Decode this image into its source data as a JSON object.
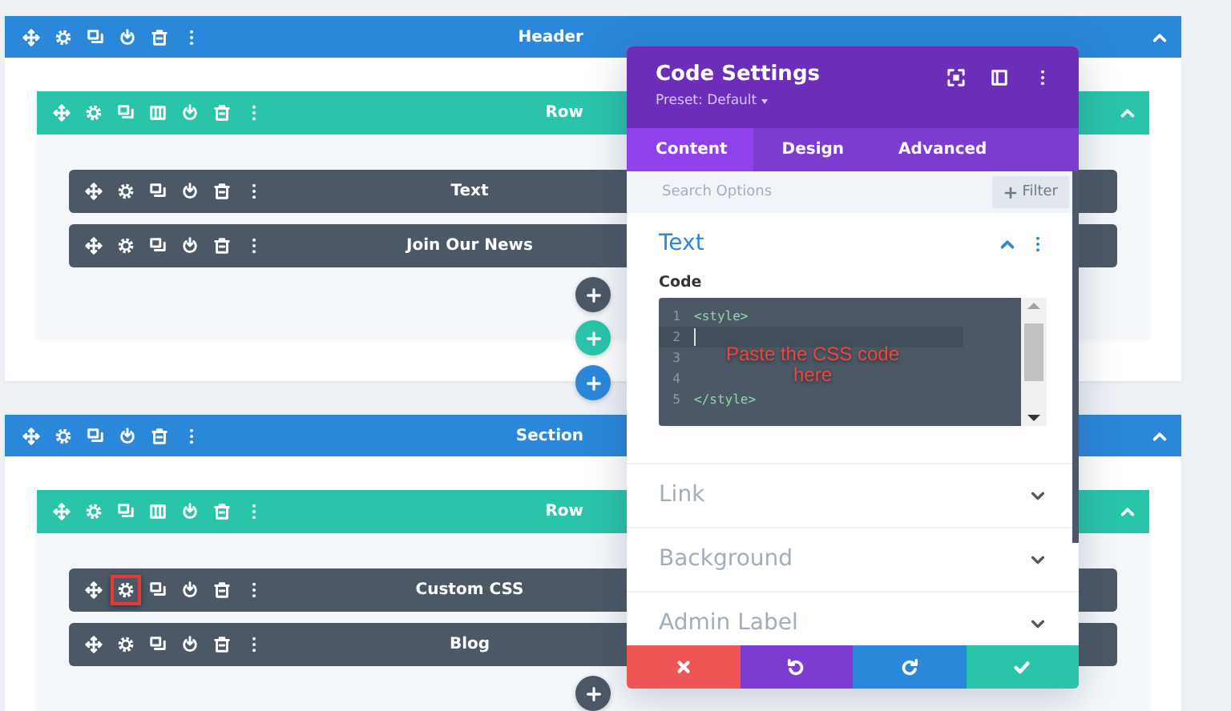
{
  "sections": [
    {
      "title": "Header",
      "add_section_button": true,
      "rows": [
        {
          "title": "Row",
          "add_row_button": true,
          "modules": [
            {
              "label": "Text",
              "settings_highlighted": false
            },
            {
              "label": "Join Our News",
              "settings_highlighted": false
            }
          ]
        }
      ]
    },
    {
      "title": "Section",
      "rows": [
        {
          "title": "Row",
          "modules": [
            {
              "label": "Custom CSS",
              "settings_highlighted": true
            },
            {
              "label": "Blog",
              "settings_highlighted": false
            }
          ]
        }
      ]
    }
  ],
  "modal": {
    "title": "Code Settings",
    "preset": "Preset: Default",
    "tabs": [
      {
        "label": "Content",
        "selected": true
      },
      {
        "label": "Design",
        "selected": false
      },
      {
        "label": "Advanced",
        "selected": false
      }
    ],
    "search": {
      "placeholder": "Search Options"
    },
    "filter_button": "Filter",
    "groups": [
      {
        "title": "Text",
        "expanded": true,
        "field_label": "Code",
        "annotation": "Paste the CSS code here",
        "code_lines": [
          {
            "number": "1",
            "code": "<style>",
            "active": false
          },
          {
            "number": "2",
            "active": true
          },
          {
            "number": "3",
            "active": false
          },
          {
            "number": "4",
            "active": false
          },
          {
            "number": "5",
            "code": "</style>",
            "active": false
          }
        ]
      },
      {
        "title": "Link",
        "expanded": false
      },
      {
        "title": "Background",
        "expanded": false
      },
      {
        "title": "Admin Label",
        "expanded": false
      }
    ],
    "footer_buttons": [
      {
        "kind": "discard"
      },
      {
        "kind": "undo"
      },
      {
        "kind": "redo"
      },
      {
        "kind": "save"
      }
    ]
  }
}
